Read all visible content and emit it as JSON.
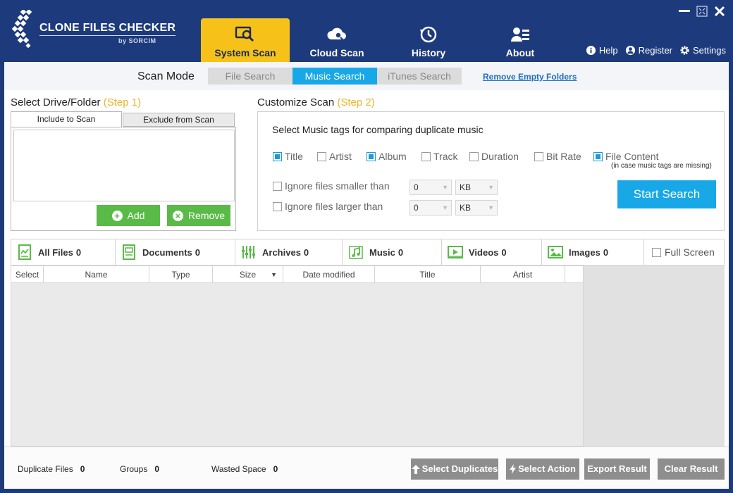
{
  "app": {
    "title": "CLONE FILES CHECKER",
    "subtitle": "by SORCIM"
  },
  "nav": {
    "tabs": [
      {
        "label": "System Scan",
        "icon": "search-screen-icon",
        "active": true
      },
      {
        "label": "Cloud Scan",
        "icon": "cloud-search-icon",
        "active": false
      },
      {
        "label": "History",
        "icon": "history-icon",
        "active": false
      },
      {
        "label": "About",
        "icon": "about-icon",
        "active": false
      }
    ],
    "links": [
      {
        "label": "Help",
        "icon": "info-icon"
      },
      {
        "label": "Register",
        "icon": "user-icon"
      },
      {
        "label": "Settings",
        "icon": "gear-icon"
      }
    ]
  },
  "scan_mode": {
    "label": "Scan Mode",
    "options": [
      "File Search",
      "Music Search",
      "iTunes Search"
    ],
    "active": "Music Search",
    "remove_empty_link": "Remove Empty Folders"
  },
  "drive": {
    "heading": "Select Drive/Folder",
    "step": "(Step 1)",
    "tab_include": "Include to Scan",
    "tab_exclude": "Exclude from Scan",
    "add_label": "Add",
    "remove_label": "Remove"
  },
  "customize": {
    "heading": "Customize Scan",
    "step": "(Step 2)",
    "title": "Select Music tags for comparing duplicate music",
    "tags": [
      {
        "label": "Title",
        "checked": true
      },
      {
        "label": "Artist",
        "checked": false
      },
      {
        "label": "Album",
        "checked": true
      },
      {
        "label": "Track",
        "checked": false
      },
      {
        "label": "Duration",
        "checked": false
      },
      {
        "label": "Bit Rate",
        "checked": false
      },
      {
        "label": "File Content",
        "checked": true
      }
    ],
    "file_content_hint": "(in case music tags are missing)",
    "ignore_smaller": {
      "label": "Ignore files smaller than",
      "checked": false,
      "value": "0",
      "unit": "KB"
    },
    "ignore_larger": {
      "label": "Ignore files larger than",
      "checked": false,
      "value": "0",
      "unit": "KB"
    },
    "start_label": "Start Search"
  },
  "categories": [
    {
      "label": "All Files",
      "count": "0",
      "icon": "all-files-icon"
    },
    {
      "label": "Documents",
      "count": "0",
      "icon": "documents-icon"
    },
    {
      "label": "Archives",
      "count": "0",
      "icon": "archives-icon"
    },
    {
      "label": "Music",
      "count": "0",
      "icon": "music-icon"
    },
    {
      "label": "Videos",
      "count": "0",
      "icon": "videos-icon"
    },
    {
      "label": "Images",
      "count": "0",
      "icon": "images-icon"
    }
  ],
  "full_screen_label": "Full Screen",
  "grid": {
    "columns": [
      "Select",
      "Name",
      "Type",
      "Size",
      "Date modified",
      "Title",
      "Artist"
    ]
  },
  "stats": {
    "duplicate_files_label": "Duplicate Files",
    "duplicate_files_value": "0",
    "groups_label": "Groups",
    "groups_value": "0",
    "wasted_space_label": "Wasted Space",
    "wasted_space_value": "0"
  },
  "actions": {
    "select_duplicates": "Select Duplicates",
    "select_action": "Select Action",
    "export_result": "Export Result",
    "clear_result": "Clear Result"
  },
  "colors": {
    "header_bg": "#1d3b7c",
    "active_tab": "#f6c21a",
    "accent_blue": "#18a8e8",
    "green": "#5aba48",
    "step_orange": "#f0b429"
  }
}
